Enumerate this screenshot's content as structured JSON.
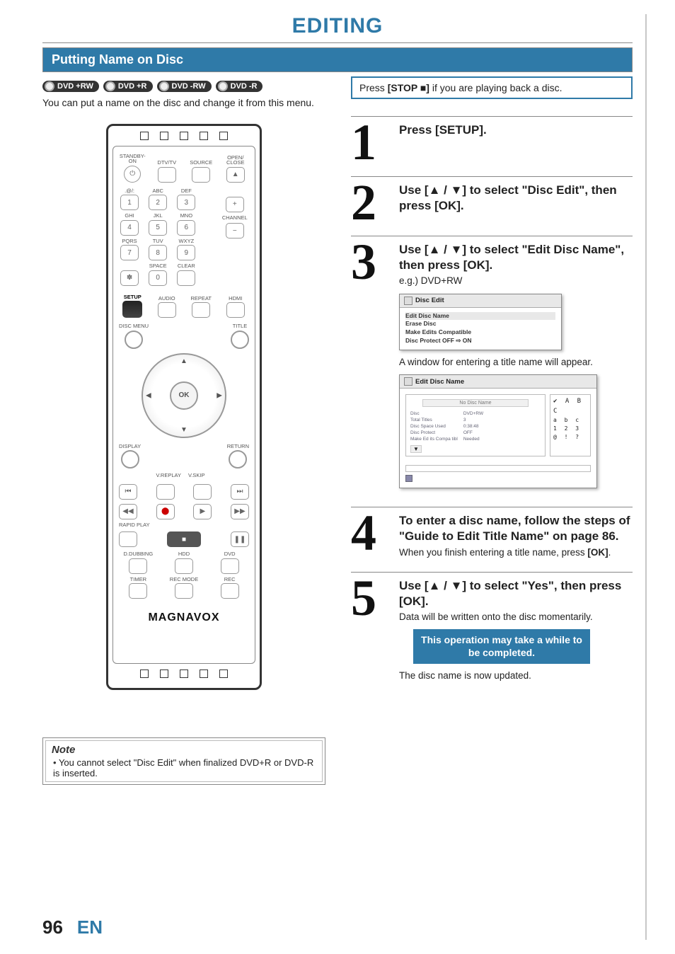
{
  "page": {
    "title": "EDITING",
    "section": "Putting Name on Disc",
    "intro": "You can put a name on the disc and change it from this menu.",
    "number": "96",
    "lang": "EN"
  },
  "disc_types": [
    "DVD +RW",
    "DVD +R",
    "DVD -RW",
    "DVD -R"
  ],
  "remote": {
    "row1": [
      "STANDBY-ON",
      "DTV/TV",
      "SOURCE",
      "OPEN/\nCLOSE"
    ],
    "row2_lbl": [
      ".@/:",
      "ABC",
      "DEF"
    ],
    "row2_num": [
      "1",
      "2",
      "3"
    ],
    "row3_lbl": [
      "GHI",
      "JKL",
      "MNO"
    ],
    "row3_num": [
      "4",
      "5",
      "6"
    ],
    "row4_lbl": [
      "PQRS",
      "TUV",
      "WXYZ"
    ],
    "row4_num": [
      "7",
      "8",
      "9"
    ],
    "row5_lbl": [
      "",
      "SPACE",
      "CLEAR"
    ],
    "row6_lbl": [
      "SETUP",
      "AUDIO",
      "REPEAT",
      "HDMI"
    ],
    "side_right": [
      "",
      "+",
      "CHANNEL",
      "−"
    ],
    "zero": "0",
    "disc_menu": "DISC MENU",
    "title_btn": "TITLE",
    "display": "DISPLAY",
    "return": "RETURN",
    "ok": "OK",
    "vreplay": "V.REPLAY",
    "vskip": "V.SKIP",
    "rapid": "RAPID PLAY",
    "ddub": "D.DUBBING",
    "hdd": "HDD",
    "dvd": "DVD",
    "timer": "TIMER",
    "recmode": "REC MODE",
    "rec": "REC",
    "brand": "MAGNAVOX"
  },
  "precheck": {
    "prefix": "Press ",
    "bold": "[STOP ■]",
    "suffix": " if you are playing back a disc."
  },
  "steps": [
    {
      "num": "1",
      "title": "Press [SETUP]."
    },
    {
      "num": "2",
      "title": "Use [▲ / ▼] to select \"Disc Edit\", then press [OK]."
    },
    {
      "num": "3",
      "title": "Use [▲ / ▼] to select \"Edit Disc Name\", then press [OK].",
      "sub": "e.g.) DVD+RW",
      "post": "A window for entering a title name will appear."
    },
    {
      "num": "4",
      "title": "To enter a disc name, follow the steps of \"Guide to Edit Title Name\" on page 86.",
      "sub_a": "When you finish entering a title name, press ",
      "sub_b": "[OK]",
      "sub_c": "."
    },
    {
      "num": "5",
      "title": "Use [▲ / ▼] to select \"Yes\", then press [OK].",
      "sub": "Data will be written onto the disc momentarily.",
      "post": "The disc name is now updated."
    }
  ],
  "osd1": {
    "title": "Disc Edit",
    "items": [
      "Edit Disc Name",
      "Erase Disc",
      "Make Edits Compatible",
      "Disc Protect OFF ⇨ ON"
    ]
  },
  "osd2": {
    "title": "Edit Disc Name",
    "field": "No Disc Name",
    "info": [
      [
        "Disc",
        "DVD+RW"
      ],
      [
        "Total Titles",
        "3"
      ],
      [
        "Disc Space Used",
        "0:38:48"
      ],
      [
        "Disc Protect",
        "OFF"
      ],
      [
        "Make Ed its Compa tibl",
        "Needed"
      ]
    ],
    "charset": [
      "✔ A  B  C",
      "   a  b  c",
      "   1  2  3",
      "   @  !  ?"
    ]
  },
  "warn": "This operation may take a while to be completed.",
  "note": {
    "heading": "Note",
    "items": [
      "You cannot select \"Disc Edit\" when finalized DVD+R or DVD-R is inserted."
    ]
  }
}
